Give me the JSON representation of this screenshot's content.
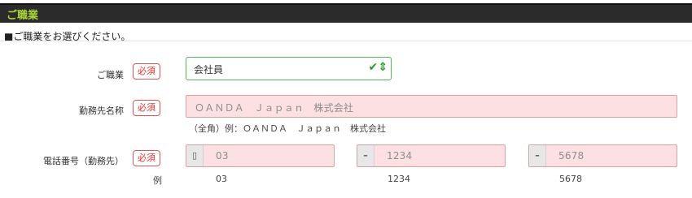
{
  "section": {
    "title": "ご職業",
    "instruction": "■ご職業をお選びください。"
  },
  "form": {
    "required_label": "必須",
    "occupation": {
      "label": "ご職業",
      "selected_value": "会社員",
      "status_icon": "check-valid-icon"
    },
    "employer": {
      "label": "勤務先名称",
      "placeholder": "ＯＡＮＤＡ　Ｊａｐａｎ　株式会社",
      "hint": "（全角）例：ＯＡＮＤＡ　Ｊａｐａｎ　株式会社"
    },
    "phone": {
      "label": "電話番号（勤務先）",
      "phone_icon": "phone-icon",
      "dash_icon": "dash-icon",
      "part1_placeholder": "03",
      "part2_placeholder": "1234",
      "part3_placeholder": "5678",
      "example_label": "例",
      "example1": "03",
      "example2": "1234",
      "example3": "5678"
    }
  },
  "colors": {
    "header_bg": "#2b2b2b",
    "header_text": "#a9d33a",
    "required_border": "#dd5555",
    "invalid_field_bg": "#fde0e2",
    "valid_border": "#56b556"
  }
}
